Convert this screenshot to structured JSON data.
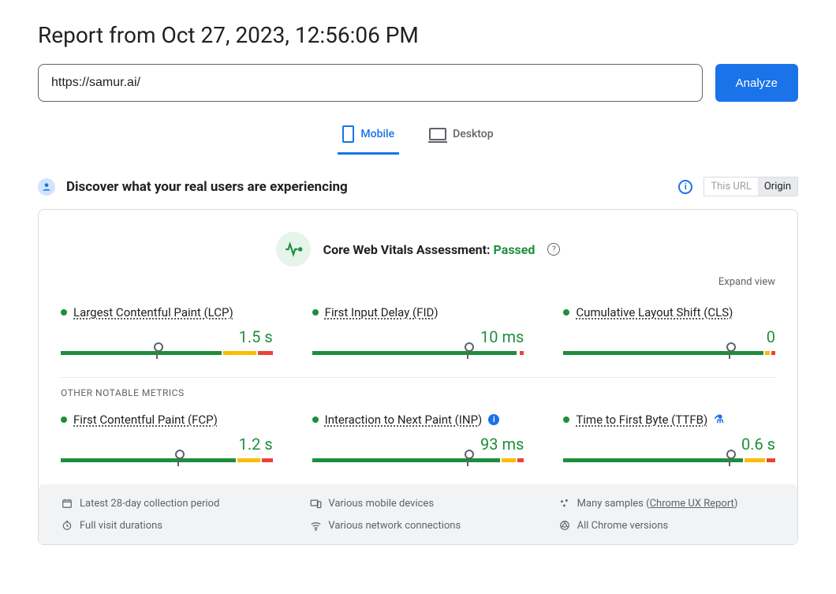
{
  "header": {
    "title": "Report from Oct 27, 2023, 12:56:06 PM",
    "url_value": "https://samur.ai/",
    "analyze_label": "Analyze"
  },
  "tabs": {
    "mobile": "Mobile",
    "desktop": "Desktop"
  },
  "section": {
    "title": "Discover what your real users are experiencing",
    "toggle_this": "This URL",
    "toggle_origin": "Origin"
  },
  "assessment": {
    "label": "Core Web Vitals Assessment: ",
    "status": "Passed",
    "expand": "Expand view"
  },
  "metrics_main": [
    {
      "name": "Largest Contentful Paint (LCP)",
      "value": "1.5 s",
      "good": 77,
      "imp": 16,
      "poor": 7,
      "marker": 45
    },
    {
      "name": "First Input Delay (FID)",
      "value": "10 ms",
      "good": 98,
      "imp": 0,
      "poor": 2,
      "marker": 73
    },
    {
      "name": "Cumulative Layout Shift (CLS)",
      "value": "0",
      "good": 96,
      "imp": 2,
      "poor": 2,
      "marker": 78
    }
  ],
  "other_label": "OTHER NOTABLE METRICS",
  "metrics_other": [
    {
      "name": "First Contentful Paint (FCP)",
      "value": "1.2 s",
      "good": 84,
      "imp": 11,
      "poor": 5,
      "marker": 55,
      "badge": ""
    },
    {
      "name": "Interaction to Next Paint (INP)",
      "value": "93 ms",
      "good": 90,
      "imp": 7,
      "poor": 3,
      "marker": 73,
      "badge": "info"
    },
    {
      "name": "Time to First Byte (TTFB)",
      "value": "0.6 s",
      "good": 86,
      "imp": 10,
      "poor": 4,
      "marker": 78,
      "badge": "exp"
    }
  ],
  "footer": {
    "period": "Latest 28-day collection period",
    "devices": "Various mobile devices",
    "samples": "Many samples",
    "samples_link": "Chrome UX Report",
    "durations": "Full visit durations",
    "network": "Various network connections",
    "versions": "All Chrome versions"
  }
}
